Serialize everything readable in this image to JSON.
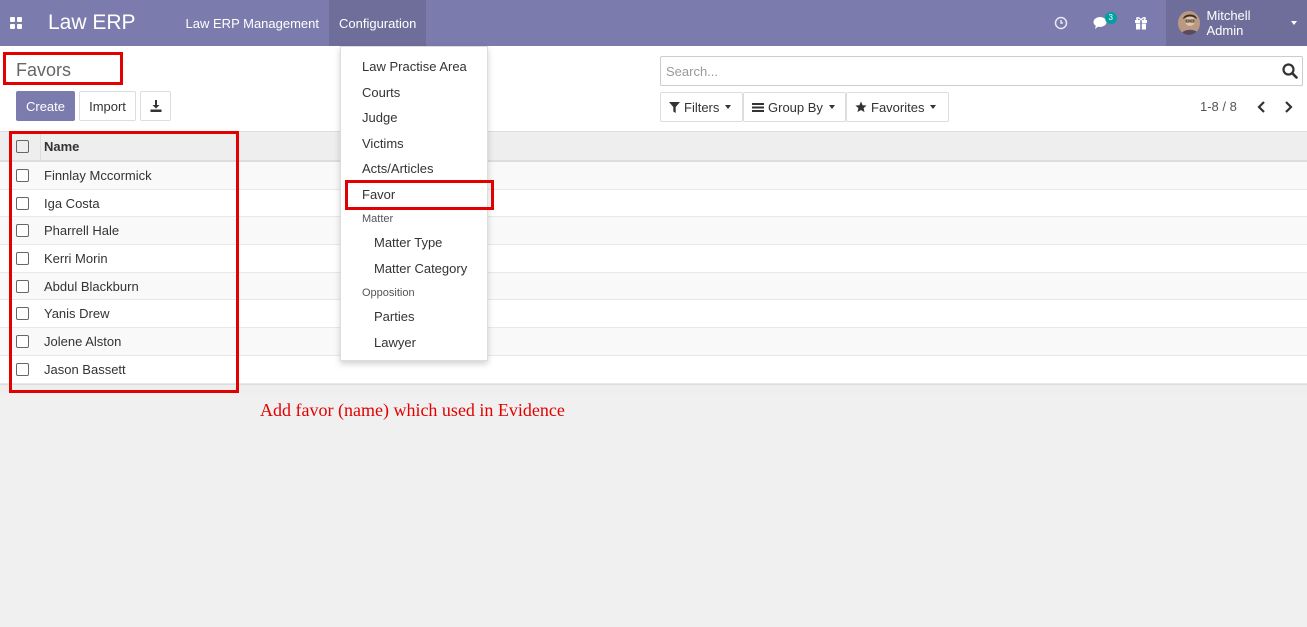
{
  "colors": {
    "brand": "#7c7bad",
    "annotation": "#e20000"
  },
  "navbar": {
    "brand": "Law ERP",
    "menus": [
      {
        "label": "Law ERP Management"
      },
      {
        "label": "Configuration"
      }
    ],
    "chat_badge": "3",
    "user": "Mitchell Admin"
  },
  "control_panel": {
    "title": "Favors",
    "create_label": "Create",
    "import_label": "Import",
    "search_placeholder": "Search...",
    "filters_label": "Filters",
    "groupby_label": "Group By",
    "favorites_label": "Favorites",
    "pager": "1-8 / 8"
  },
  "table": {
    "header": "Name",
    "rows": [
      "Finnlay Mccormick",
      "Iga Costa",
      "Pharrell Hale",
      "Kerri Morin",
      "Abdul Blackburn",
      "Yanis Drew",
      "Jolene Alston",
      "Jason Bassett"
    ]
  },
  "dropdown": {
    "items": [
      "Law Practise Area",
      "Courts",
      "Judge",
      "Victims",
      "Acts/Articles",
      "Favor"
    ],
    "matter_header": "Matter",
    "matter_items": [
      "Matter Type",
      "Matter Category"
    ],
    "opposition_header": "Opposition",
    "opposition_items": [
      "Parties",
      "Lawyer"
    ]
  },
  "annotation": "Add favor (name) which used in Evidence"
}
